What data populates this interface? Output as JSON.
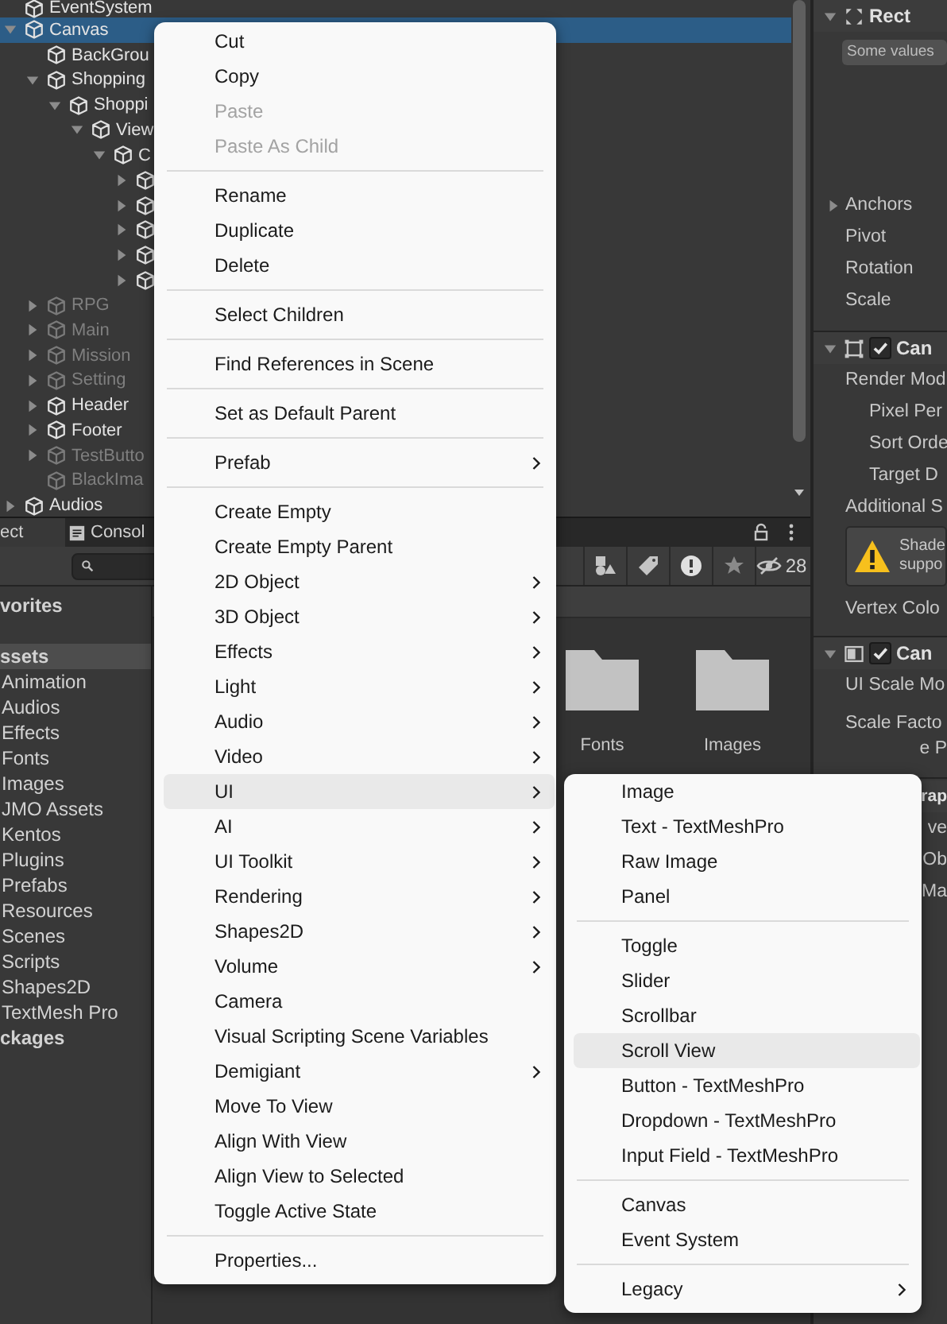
{
  "hierarchy": {
    "items": [
      {
        "label": "EventSystem",
        "selected": false,
        "active": true
      },
      {
        "label": "Canvas",
        "selected": true,
        "active": true,
        "expanded": true,
        "children": [
          {
            "label": "BackGrou",
            "selected": false,
            "active": true
          },
          {
            "label": "Shopping",
            "selected": false,
            "active": true,
            "expanded": true,
            "children": [
              {
                "label": "Shoppi",
                "selected": false,
                "active": true,
                "expanded": true,
                "children": [
                  {
                    "label": "View",
                    "selected": false,
                    "active": true,
                    "expanded": true,
                    "children": [
                      {
                        "label": "C",
                        "selected": false,
                        "active": true,
                        "expanded": true,
                        "children": [
                          {
                            "selected": false,
                            "active": true,
                            "expanded": false
                          },
                          {
                            "selected": false,
                            "active": true,
                            "expanded": false
                          },
                          {
                            "selected": false,
                            "active": true,
                            "expanded": false
                          },
                          {
                            "selected": false,
                            "active": true,
                            "expanded": false
                          },
                          {
                            "selected": false,
                            "active": true,
                            "expanded": false
                          }
                        ]
                      }
                    ]
                  }
                ]
              }
            ]
          },
          {
            "label": "RPG",
            "selected": false,
            "active": false,
            "expanded": false
          },
          {
            "label": "Main",
            "selected": false,
            "active": false,
            "expanded": false
          },
          {
            "label": "Mission",
            "selected": false,
            "active": false,
            "expanded": false
          },
          {
            "label": "Setting",
            "selected": false,
            "active": false,
            "expanded": false
          },
          {
            "label": "Header",
            "selected": false,
            "active": true,
            "expanded": false
          },
          {
            "label": "Footer",
            "selected": false,
            "active": true,
            "expanded": false
          },
          {
            "label": "TestButto",
            "selected": false,
            "active": false,
            "expanded": false
          },
          {
            "label": "BlackIma",
            "selected": false,
            "active": false
          }
        ]
      },
      {
        "label": "Audios",
        "selected": false,
        "active": true,
        "expanded": false
      }
    ]
  },
  "project": {
    "tabs": [
      {
        "label": "ect",
        "kind": "project",
        "selected": true
      },
      {
        "label": "Consol",
        "kind": "console",
        "selected": false
      }
    ],
    "hidden_count": "28",
    "tree": [
      {
        "label": "vorites",
        "selected": false
      },
      {
        "label": "ssets",
        "selected": true,
        "children": [
          {
            "label": "Animation",
            "selected": false
          },
          {
            "label": "Audios",
            "selected": false
          },
          {
            "label": "Effects",
            "selected": false
          },
          {
            "label": "Fonts",
            "selected": false
          },
          {
            "label": "Images",
            "selected": false
          },
          {
            "label": "JMO Assets",
            "selected": false
          },
          {
            "label": "Kentos",
            "selected": false
          },
          {
            "label": "Plugins",
            "selected": false
          },
          {
            "label": "Prefabs",
            "selected": false
          },
          {
            "label": "Resources",
            "selected": false
          },
          {
            "label": "Scenes",
            "selected": false
          },
          {
            "label": "Scripts",
            "selected": false
          },
          {
            "label": "Shapes2D",
            "selected": false
          },
          {
            "label": "TextMesh Pro",
            "selected": false
          }
        ]
      },
      {
        "label": "ckages",
        "selected": false
      }
    ],
    "folders": [
      "Fonts",
      "Images"
    ]
  },
  "inspector": {
    "components": [
      {
        "kind": "rect_transform",
        "title": "Rect",
        "expanded": true,
        "mixed_values": "Some values",
        "properties": [
          {
            "label": "Anchors",
            "expanded": false
          },
          {
            "label": "Pivot"
          },
          {
            "label": "Rotation"
          },
          {
            "label": "Scale"
          }
        ]
      },
      {
        "kind": "canvas",
        "title": "Can",
        "expanded": true,
        "enabled": true,
        "properties": [
          {
            "kind": "field",
            "label": "Render Mod",
            "children": [
              {
                "label": "Pixel Per"
              },
              {
                "label": "Sort Orde"
              },
              {
                "label": "Target D"
              }
            ]
          },
          {
            "kind": "field",
            "label": "Additional S"
          },
          {
            "kind": "warning",
            "lines": [
              "Shade",
              "suppo"
            ]
          },
          {
            "kind": "field",
            "label": "Vertex Colo"
          }
        ]
      },
      {
        "kind": "canvas_scaler",
        "title": "Can",
        "expanded": true,
        "enabled": true,
        "properties": [
          {
            "kind": "field",
            "label": "UI Scale Mo"
          },
          {
            "kind": "field",
            "label": "Scale Facto"
          },
          {
            "kind": "clipped",
            "label": "e P"
          }
        ]
      },
      {
        "kind": "clipped",
        "title": "rap",
        "properties": [
          {
            "kind": "clipped",
            "label": "ve"
          },
          {
            "kind": "clipped",
            "label": "Ob"
          },
          {
            "kind": "clipped",
            "label": "Ma"
          }
        ]
      }
    ]
  },
  "context_menu": {
    "items": [
      {
        "kind": "item",
        "label": "Cut",
        "disabled": false,
        "submenu": false,
        "selected": false
      },
      {
        "kind": "item",
        "label": "Copy",
        "disabled": false,
        "submenu": false,
        "selected": false
      },
      {
        "kind": "item",
        "label": "Paste",
        "disabled": true,
        "submenu": false,
        "selected": false
      },
      {
        "kind": "item",
        "label": "Paste As Child",
        "disabled": true,
        "submenu": false,
        "selected": false
      },
      {
        "kind": "separator"
      },
      {
        "kind": "item",
        "label": "Rename",
        "disabled": false,
        "submenu": false,
        "selected": false
      },
      {
        "kind": "item",
        "label": "Duplicate",
        "disabled": false,
        "submenu": false,
        "selected": false
      },
      {
        "kind": "item",
        "label": "Delete",
        "disabled": false,
        "submenu": false,
        "selected": false
      },
      {
        "kind": "separator"
      },
      {
        "kind": "item",
        "label": "Select Children",
        "disabled": false,
        "submenu": false,
        "selected": false
      },
      {
        "kind": "separator"
      },
      {
        "kind": "item",
        "label": "Find References in Scene",
        "disabled": false,
        "submenu": false,
        "selected": false
      },
      {
        "kind": "separator"
      },
      {
        "kind": "item",
        "label": "Set as Default Parent",
        "disabled": false,
        "submenu": false,
        "selected": false
      },
      {
        "kind": "separator"
      },
      {
        "kind": "item",
        "label": "Prefab",
        "disabled": false,
        "submenu": true,
        "selected": false
      },
      {
        "kind": "separator"
      },
      {
        "kind": "item",
        "label": "Create Empty",
        "disabled": false,
        "submenu": false,
        "selected": false
      },
      {
        "kind": "item",
        "label": "Create Empty Parent",
        "disabled": false,
        "submenu": false,
        "selected": false
      },
      {
        "kind": "item",
        "label": "2D Object",
        "disabled": false,
        "submenu": true,
        "selected": false
      },
      {
        "kind": "item",
        "label": "3D Object",
        "disabled": false,
        "submenu": true,
        "selected": false
      },
      {
        "kind": "item",
        "label": "Effects",
        "disabled": false,
        "submenu": true,
        "selected": false
      },
      {
        "kind": "item",
        "label": "Light",
        "disabled": false,
        "submenu": true,
        "selected": false
      },
      {
        "kind": "item",
        "label": "Audio",
        "disabled": false,
        "submenu": true,
        "selected": false
      },
      {
        "kind": "item",
        "label": "Video",
        "disabled": false,
        "submenu": true,
        "selected": false
      },
      {
        "kind": "item",
        "label": "UI",
        "disabled": false,
        "submenu": true,
        "selected": true
      },
      {
        "kind": "item",
        "label": "AI",
        "disabled": false,
        "submenu": true,
        "selected": false
      },
      {
        "kind": "item",
        "label": "UI Toolkit",
        "disabled": false,
        "submenu": true,
        "selected": false
      },
      {
        "kind": "item",
        "label": "Rendering",
        "disabled": false,
        "submenu": true,
        "selected": false
      },
      {
        "kind": "item",
        "label": "Shapes2D",
        "disabled": false,
        "submenu": true,
        "selected": false
      },
      {
        "kind": "item",
        "label": "Volume",
        "disabled": false,
        "submenu": true,
        "selected": false
      },
      {
        "kind": "item",
        "label": "Camera",
        "disabled": false,
        "submenu": false,
        "selected": false
      },
      {
        "kind": "item",
        "label": "Visual Scripting Scene Variables",
        "disabled": false,
        "submenu": false,
        "selected": false
      },
      {
        "kind": "item",
        "label": "Demigiant",
        "disabled": false,
        "submenu": true,
        "selected": false
      },
      {
        "kind": "item",
        "label": "Move To View",
        "disabled": false,
        "submenu": false,
        "selected": false
      },
      {
        "kind": "item",
        "label": "Align With View",
        "disabled": false,
        "submenu": false,
        "selected": false
      },
      {
        "kind": "item",
        "label": "Align View to Selected",
        "disabled": false,
        "submenu": false,
        "selected": false
      },
      {
        "kind": "item",
        "label": "Toggle Active State",
        "disabled": false,
        "submenu": false,
        "selected": false
      },
      {
        "kind": "separator"
      },
      {
        "kind": "item",
        "label": "Properties...",
        "disabled": false,
        "submenu": false,
        "selected": false
      }
    ]
  },
  "submenu": {
    "items": [
      {
        "kind": "item",
        "label": "Image",
        "disabled": false,
        "submenu": false,
        "selected": false
      },
      {
        "kind": "item",
        "label": "Text - TextMeshPro",
        "disabled": false,
        "submenu": false,
        "selected": false
      },
      {
        "kind": "item",
        "label": "Raw Image",
        "disabled": false,
        "submenu": false,
        "selected": false
      },
      {
        "kind": "item",
        "label": "Panel",
        "disabled": false,
        "submenu": false,
        "selected": false
      },
      {
        "kind": "separator"
      },
      {
        "kind": "item",
        "label": "Toggle",
        "disabled": false,
        "submenu": false,
        "selected": false
      },
      {
        "kind": "item",
        "label": "Slider",
        "disabled": false,
        "submenu": false,
        "selected": false
      },
      {
        "kind": "item",
        "label": "Scrollbar",
        "disabled": false,
        "submenu": false,
        "selected": false
      },
      {
        "kind": "item",
        "label": "Scroll View",
        "disabled": false,
        "submenu": false,
        "selected": true
      },
      {
        "kind": "item",
        "label": "Button - TextMeshPro",
        "disabled": false,
        "submenu": false,
        "selected": false
      },
      {
        "kind": "item",
        "label": "Dropdown - TextMeshPro",
        "disabled": false,
        "submenu": false,
        "selected": false
      },
      {
        "kind": "item",
        "label": "Input Field - TextMeshPro",
        "disabled": false,
        "submenu": false,
        "selected": false
      },
      {
        "kind": "separator"
      },
      {
        "kind": "item",
        "label": "Canvas",
        "disabled": false,
        "submenu": false,
        "selected": false
      },
      {
        "kind": "item",
        "label": "Event System",
        "disabled": false,
        "submenu": false,
        "selected": false
      },
      {
        "kind": "separator"
      },
      {
        "kind": "item",
        "label": "Legacy",
        "disabled": false,
        "submenu": true,
        "selected": false
      }
    ]
  }
}
